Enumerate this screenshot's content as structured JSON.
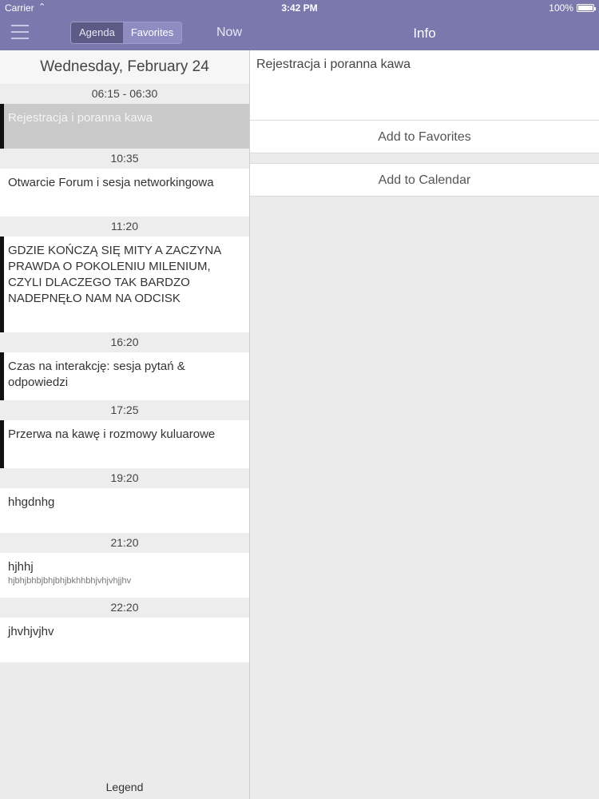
{
  "status": {
    "carrier": "Carrier",
    "time": "3:42 PM",
    "battery": "100%"
  },
  "nav": {
    "segments": [
      "Agenda",
      "Favorites"
    ],
    "now": "Now",
    "info_title": "Info"
  },
  "agenda": {
    "day": "Wednesday, February 24",
    "slots": [
      {
        "time": "06:15 - 06:30",
        "title": "Rejestracja i poranna kawa",
        "sub": ""
      },
      {
        "time": "10:35",
        "title": "Otwarcie Forum i sesja networkingowa",
        "sub": ""
      },
      {
        "time": "11:20",
        "title": "GDZIE KOŃCZĄ SIĘ MITY A ZACZYNA PRAWDA O POKOLENIU MILENIUM, CZYLI DLACZEGO TAK BARDZO NADEPNĘŁO NAM NA ODCISK",
        "sub": ""
      },
      {
        "time": "16:20",
        "title": "Czas na interakcję: sesja pytań & odpowiedzi",
        "sub": ""
      },
      {
        "time": "17:25",
        "title": "Przerwa na kawę i rozmowy kuluarowe",
        "sub": ""
      },
      {
        "time": "19:20",
        "title": "hhgdnhg",
        "sub": ""
      },
      {
        "time": "21:20",
        "title": "hjhhj",
        "sub": "hjbhjbhbjbhjbhjbkhhbhjvhjvhjjhv"
      },
      {
        "time": "22:20",
        "title": "jhvhjvjhv",
        "sub": ""
      }
    ],
    "legend": "Legend"
  },
  "info": {
    "selected_title": "Rejestracja i poranna kawa",
    "add_favorites": "Add to Favorites",
    "add_calendar": "Add to Calendar"
  },
  "colors": {
    "nav_bg": "#7b78ae",
    "item_bar": "#111111",
    "selected_bg": "#c9c9c9"
  }
}
